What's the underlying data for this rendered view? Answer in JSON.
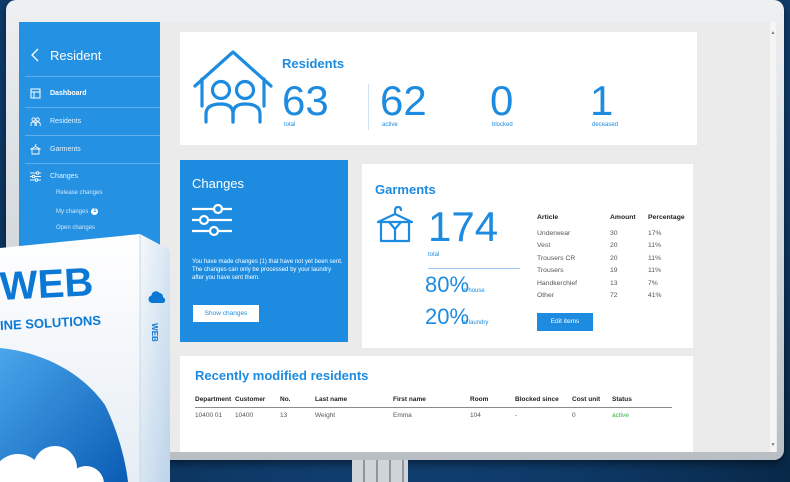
{
  "sidebar": {
    "back_icon": "chevron-left-icon",
    "title": "Resident",
    "items": [
      {
        "label": "Dashboard",
        "icon": "dashboard-icon",
        "active": true
      },
      {
        "label": "Residents",
        "icon": "residents-icon",
        "active": false
      },
      {
        "label": "Garments",
        "icon": "garments-icon",
        "active": false
      },
      {
        "label": "Changes",
        "icon": "sliders-icon",
        "active": false,
        "children": [
          {
            "label": "Release changes"
          },
          {
            "label": "My changes",
            "badge": "1"
          },
          {
            "label": "Open changes"
          }
        ]
      }
    ]
  },
  "residents": {
    "title": "Residents",
    "icon": "house-residents-icon",
    "stats": [
      {
        "value": "63",
        "label": "total"
      },
      {
        "value": "62",
        "label": "active"
      },
      {
        "value": "0",
        "label": "blocked"
      },
      {
        "value": "1",
        "label": "deceased"
      }
    ]
  },
  "changes": {
    "title": "Changes",
    "icon": "sliders-icon",
    "message": "You have made changes (1) that have not yet been sent. The changes can only be processed by your laundry after you have sent them.",
    "button_label": "Show changes"
  },
  "garments": {
    "title": "Garments",
    "icon": "hanger-shirt-icon",
    "total": {
      "value": "174",
      "label": "total"
    },
    "in_house": {
      "value": "80%",
      "label": "in house"
    },
    "at_laundry": {
      "value": "20%",
      "label": "at laundry"
    },
    "columns": [
      "Article",
      "Amount",
      "Percentage"
    ],
    "rows": [
      [
        "Underwear",
        "30",
        "17%"
      ],
      [
        "Vest",
        "20",
        "11%"
      ],
      [
        "Trousers CR",
        "20",
        "11%"
      ],
      [
        "Trousers",
        "19",
        "11%"
      ],
      [
        "Handkerchief",
        "13",
        "7%"
      ],
      [
        "Other",
        "72",
        "41%"
      ]
    ],
    "button_label": "Edit items"
  },
  "recent_residents": {
    "title": "Recently modified residents",
    "columns": [
      "Department",
      "Customer",
      "No.",
      "Last name",
      "First name",
      "Room",
      "Blocked since",
      "Cost unit",
      "Status"
    ],
    "rows": [
      [
        "10400 01",
        "10400",
        "13",
        "Weight",
        "Emma",
        "104",
        "-",
        "0",
        "active"
      ]
    ]
  },
  "product_box": {
    "brand": "WEB",
    "tagline": "INE SOLUTIONS",
    "side_label": "WEB",
    "icon": "cloud-icon"
  },
  "colors": {
    "primary": "#1d8ce0",
    "sidebar": "#2591e2",
    "status_active": "#3aae3f",
    "brand": "#0b78d6"
  }
}
